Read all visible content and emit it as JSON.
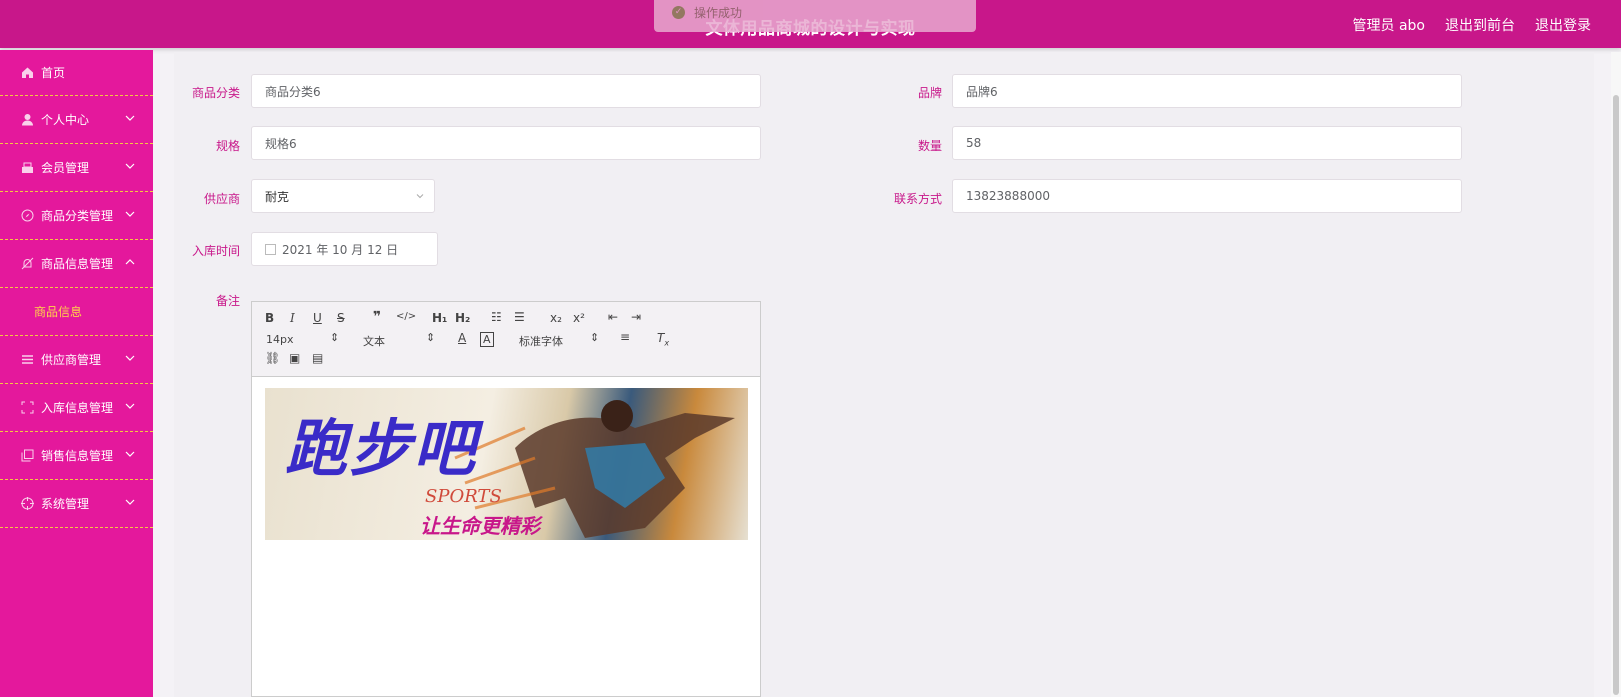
{
  "header": {
    "title": "文体用品商城的设计与实现",
    "toast": "操作成功",
    "links": [
      "管理员 abo",
      "退出到前台",
      "退出登录"
    ]
  },
  "sidebar": {
    "items": [
      {
        "label": "首页",
        "icon": "home-icon"
      },
      {
        "label": "个人中心",
        "icon": "user-icon"
      },
      {
        "label": "会员管理",
        "icon": "members-icon"
      },
      {
        "label": "商品分类管理",
        "icon": "compass-icon"
      },
      {
        "label": "商品信息管理",
        "icon": "no-bell-icon"
      },
      {
        "label": "供应商管理",
        "icon": "list-icon"
      },
      {
        "label": "入库信息管理",
        "icon": "fullscreen-icon"
      },
      {
        "label": "销售信息管理",
        "icon": "copy-icon"
      },
      {
        "label": "系统管理",
        "icon": "target-icon"
      }
    ],
    "submenu": "商品信息"
  },
  "form": {
    "category_label": "商品分类",
    "category_value": "商品分类6",
    "brand_label": "品牌",
    "brand_value": "品牌6",
    "spec_label": "规格",
    "spec_value": "规格6",
    "qty_label": "数量",
    "qty_value": "58",
    "supplier_label": "供应商",
    "supplier_value": "耐克",
    "contact_label": "联系方式",
    "contact_value": "13823888000",
    "date_label": "入库时间",
    "date_value": "2021 年 10 月 12 日",
    "remark_label": "备注"
  },
  "editor": {
    "size_value": "14px",
    "header_value": "文本",
    "font_value": "标准字体",
    "banner_main": "跑步吧",
    "banner_sports": "SPORTS",
    "banner_slogan": "让生命更精彩"
  },
  "colors": {
    "primary": "#c8178a",
    "sidebar": "#e4189c",
    "submenu_active": "#ffd54a",
    "divider": "#f5c842"
  }
}
